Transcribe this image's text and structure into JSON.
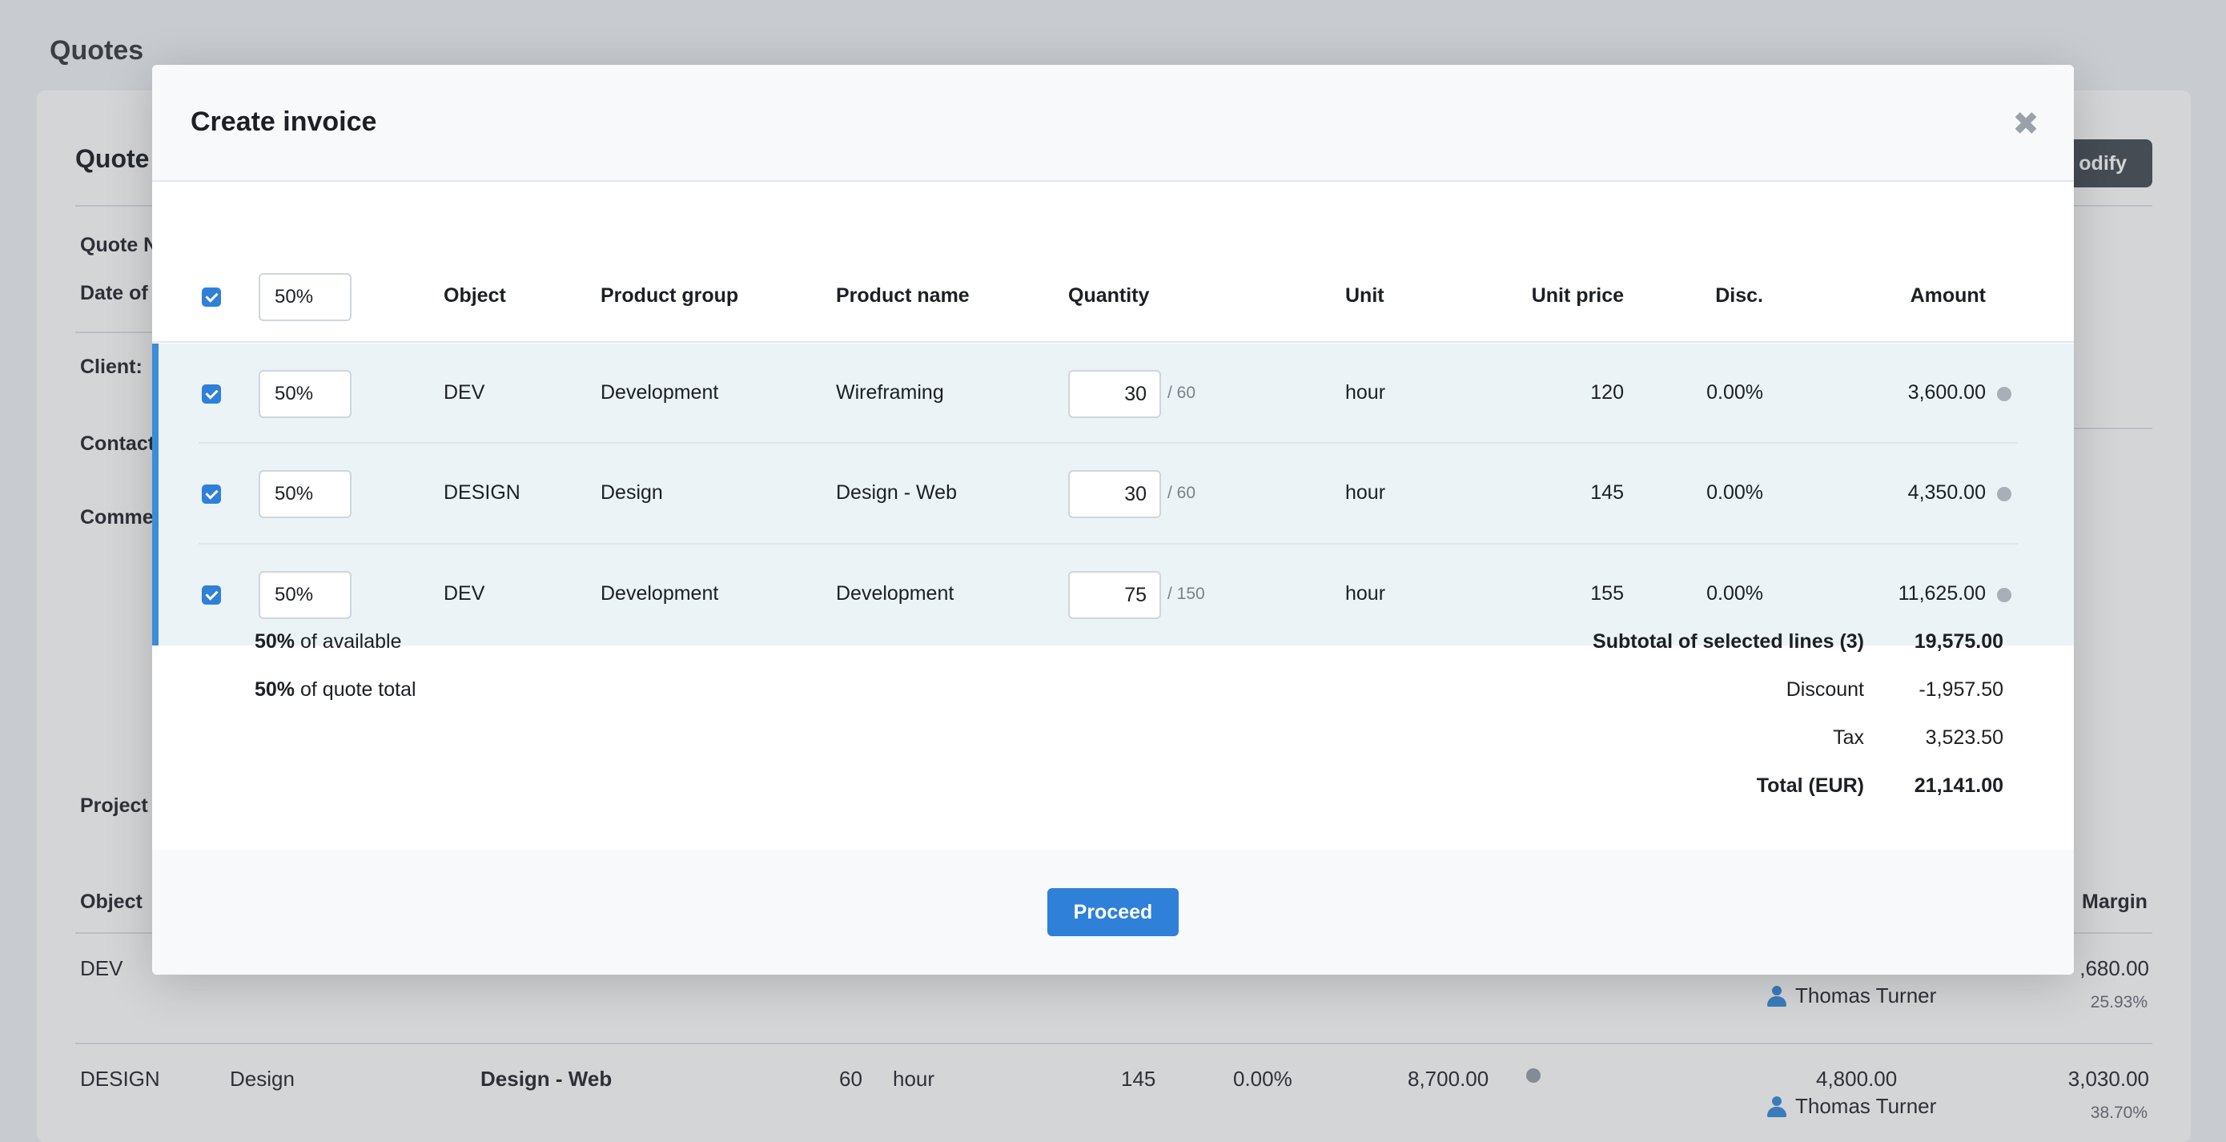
{
  "background": {
    "page_title": "Quotes",
    "card_title": "Quote",
    "modify_label": "odify",
    "labels": {
      "quote_number": "Quote N",
      "date_of": "Date of",
      "client": "Client:",
      "contact": "Contact",
      "comments": "Comme",
      "project": "Project"
    },
    "table_headers": {
      "object": "Object",
      "margin": "Margin"
    },
    "rows": [
      {
        "object": "DEV",
        "person": "Thomas Turner",
        "margin": ",680.00",
        "margin_pct": "25.93%"
      },
      {
        "object": "DESIGN",
        "group": "Design",
        "product": "Design - Web",
        "quantity": "60",
        "unit": "hour",
        "unit_price": "145",
        "disc": "0.00%",
        "amount": "8,700.00",
        "cost": "4,800.00",
        "person": "Thomas Turner",
        "margin": "3,030.00",
        "margin_pct": "38.70%"
      }
    ]
  },
  "modal": {
    "title": "Create invoice",
    "close_label": "✖",
    "header_percent": "50%",
    "columns": {
      "object": "Object",
      "product_group": "Product group",
      "product_name": "Product name",
      "quantity": "Quantity",
      "unit": "Unit",
      "unit_price": "Unit price",
      "disc": "Disc.",
      "amount": "Amount"
    },
    "lines": [
      {
        "percent": "50%",
        "object": "DEV",
        "product_group": "Development",
        "product_name": "Wireframing",
        "quantity": "30",
        "max_quantity": "/ 60",
        "unit": "hour",
        "unit_price": "120",
        "disc": "0.00%",
        "amount": "3,600.00"
      },
      {
        "percent": "50%",
        "object": "DESIGN",
        "product_group": "Design",
        "product_name": "Design - Web",
        "quantity": "30",
        "max_quantity": "/ 60",
        "unit": "hour",
        "unit_price": "145",
        "disc": "0.00%",
        "amount": "4,350.00"
      },
      {
        "percent": "50%",
        "object": "DEV",
        "product_group": "Development",
        "product_name": "Development",
        "quantity": "75",
        "max_quantity": "/ 150",
        "unit": "hour",
        "unit_price": "155",
        "disc": "0.00%",
        "amount": "11,625.00"
      }
    ],
    "summary": {
      "available_pct": "50%",
      "available_text": "of available",
      "quote_pct": "50%",
      "quote_text": "of quote total",
      "subtotal_label": "Subtotal of selected lines (3)",
      "subtotal_value": "19,575.00",
      "discount_label": "Discount",
      "discount_value": "-1,957.50",
      "tax_label": "Tax",
      "tax_value": "3,523.50",
      "total_label": "Total (EUR)",
      "total_value": "21,141.00"
    },
    "proceed_label": "Proceed"
  }
}
